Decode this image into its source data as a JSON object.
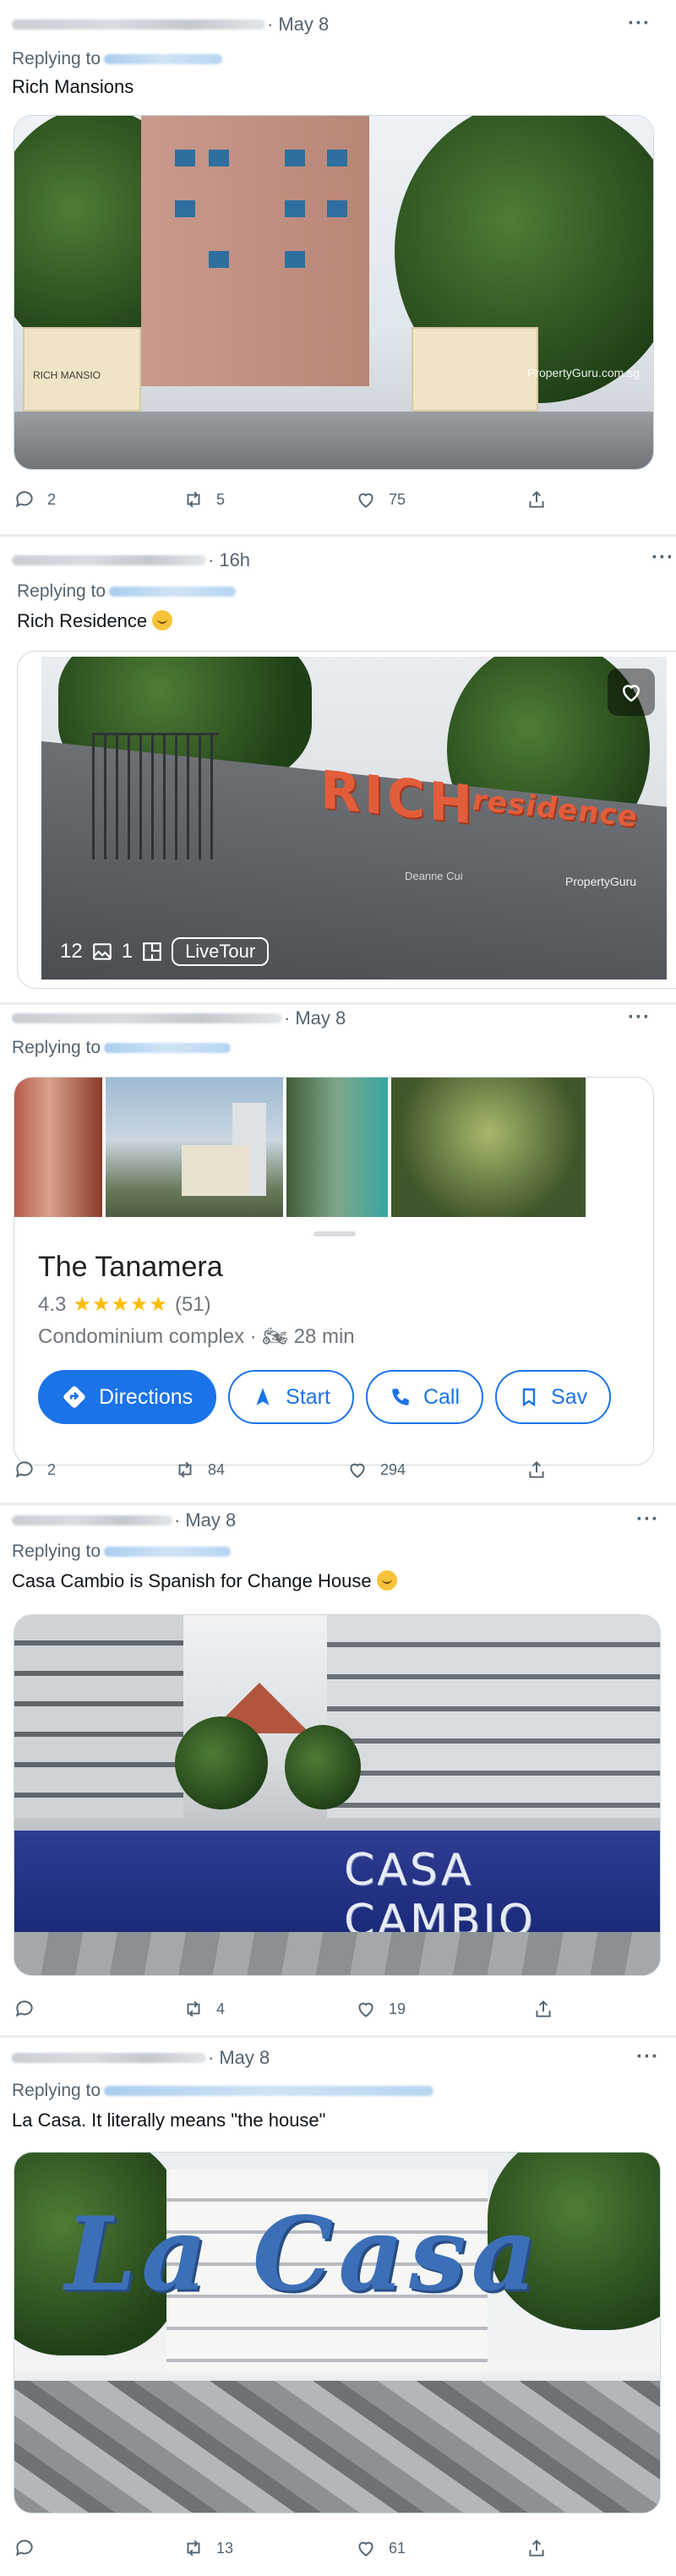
{
  "posts": [
    {
      "time": "May 8",
      "more": "···",
      "replying": "Replying to",
      "text": "Rich Mansions",
      "photo": {
        "watermark": "PropertyGuru.com.sg",
        "gate_sign": "RICH MANSIO"
      },
      "actions": {
        "replies": "2",
        "retweets": "5",
        "likes": "75"
      }
    },
    {
      "time": "16h",
      "more": "···",
      "replying": "Replying to",
      "text": "Rich Residence",
      "photo": {
        "sign_main": "RICH",
        "sign_script": "residence",
        "agent": "Deanne Cui",
        "watermark": "PropertyGuru",
        "photos": "12",
        "plans": "1",
        "live_tour": "LiveTour"
      }
    },
    {
      "time": "May 8",
      "more": "···",
      "replying": "Replying to",
      "map_card": {
        "name": "The Tanamera",
        "rating": "4.3",
        "stars": "★★★★★",
        "reviews": "(51)",
        "category": "Condominium complex",
        "travel": "28 min",
        "buttons": {
          "directions": "Directions",
          "start": "Start",
          "call": "Call",
          "save": "Sav"
        }
      },
      "actions": {
        "replies": "2",
        "retweets": "84",
        "likes": "294"
      }
    },
    {
      "time": "May 8",
      "more": "···",
      "replying": "Replying to",
      "text": "Casa Cambio is Spanish for Change House",
      "photo": {
        "sign": "CASA CAMBIO"
      },
      "actions": {
        "replies": "",
        "retweets": "4",
        "likes": "19"
      }
    },
    {
      "time": "May 8",
      "more": "···",
      "replying": "Replying to",
      "text": "La Casa. It literally means \"the house\"",
      "photo": {
        "sign": "La Casa"
      },
      "actions": {
        "replies": "",
        "retweets": "13",
        "likes": "61"
      }
    }
  ],
  "colors": {
    "muted": "#536471",
    "text": "#0f1419",
    "maps_blue": "#1a73e8",
    "star": "#fbbc04"
  },
  "icons": [
    "reply-icon",
    "retweet-icon",
    "like-icon",
    "share-icon",
    "heart-icon",
    "photos-icon",
    "floorplan-icon",
    "directions-icon",
    "navigation-icon",
    "phone-icon",
    "bookmark-icon",
    "motorbike-icon"
  ]
}
